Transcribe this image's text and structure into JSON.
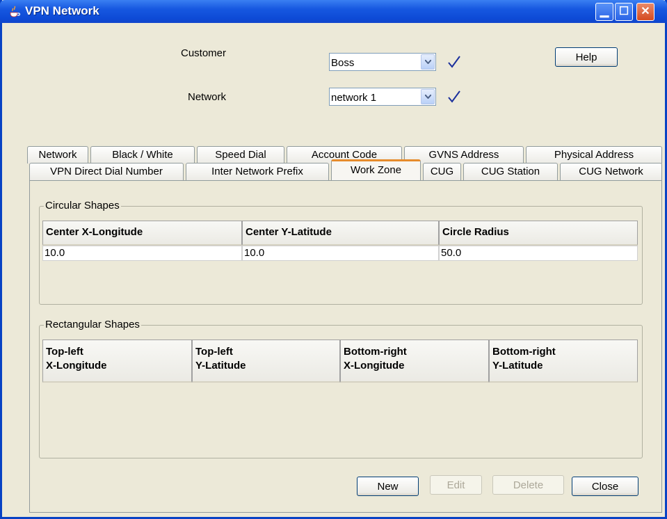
{
  "window": {
    "title": "VPN Network",
    "controls": [
      "minimize-icon",
      "maximize-icon",
      "close-icon"
    ]
  },
  "form": {
    "customer_label": "Customer",
    "customer_value": "Boss",
    "network_label": "Network",
    "network_value": "network 1",
    "help_label": "Help"
  },
  "tabs_row1": [
    "Network",
    "Black / White",
    "Speed Dial",
    "Account Code",
    "GVNS Address",
    "Physical Address"
  ],
  "tabs_row2": [
    "VPN Direct Dial Number",
    "Inter Network Prefix",
    "Work Zone",
    "CUG",
    "CUG Station",
    "CUG Network"
  ],
  "selected_tab": "Work Zone",
  "circular": {
    "title": "Circular Shapes",
    "headers": [
      "Center X-Longitude",
      "Center Y-Latitude",
      "Circle Radius"
    ],
    "rows": [
      [
        "10.0",
        "10.0",
        "50.0"
      ]
    ]
  },
  "rectangular": {
    "title": "Rectangular Shapes",
    "headers": [
      [
        "Top-left",
        "X-Longitude"
      ],
      [
        "Top-left",
        "Y-Latitude"
      ],
      [
        "Bottom-right",
        "X-Longitude"
      ],
      [
        "Bottom-right",
        "Y-Latitude"
      ]
    ],
    "rows": []
  },
  "buttons": {
    "new": "New",
    "edit": "Edit",
    "delete": "Delete",
    "close": "Close"
  },
  "colors": {
    "titlebar": "#0d4ad6",
    "check": "#1a2f9c",
    "tab_highlight": "#e68b2c"
  }
}
